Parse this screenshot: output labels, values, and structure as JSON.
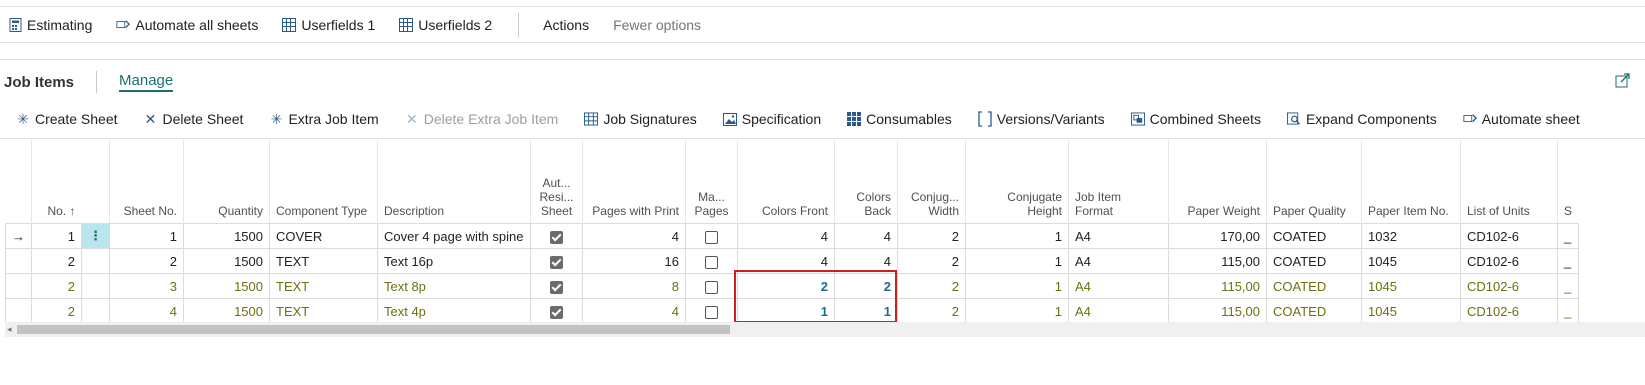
{
  "top_actions": {
    "estimating": "Estimating",
    "automate_all": "Automate all sheets",
    "userfields1": "Userfields 1",
    "userfields2": "Userfields 2",
    "actions": "Actions",
    "fewer_options": "Fewer options"
  },
  "part": {
    "title": "Job Items",
    "manage": "Manage"
  },
  "ribbon": {
    "create_sheet": "Create Sheet",
    "delete_sheet": "Delete Sheet",
    "extra_job_item": "Extra Job Item",
    "delete_extra_job_item": "Delete Extra Job Item",
    "job_signatures": "Job Signatures",
    "specification": "Specification",
    "consumables": "Consumables",
    "versions_variants": "Versions/Variants",
    "combined_sheets": "Combined Sheets",
    "expand_components": "Expand Components",
    "automate_sheet": "Automate sheet"
  },
  "columns": {
    "no": "No.",
    "sort": "↑",
    "sheet_no": "Sheet No.",
    "quantity": "Quantity",
    "component_type": "Component Type",
    "description": "Description",
    "auto_resize_1": "Aut...",
    "auto_resize_2": "Resi...",
    "auto_resize_3": "Sheet",
    "pages_with_print": "Pages with Print",
    "manual_pages_1": "Ma...",
    "manual_pages_2": "Pages",
    "colors_front": "Colors Front",
    "colors_back_1": "Colors",
    "colors_back_2": "Back",
    "conj_width_1": "Conjug...",
    "conj_width_2": "Width",
    "conj_height_1": "Conjugate",
    "conj_height_2": "Height",
    "format_1": "Job Item",
    "format_2": "Format",
    "paper_weight": "Paper Weight",
    "paper_quality": "Paper Quality",
    "paper_item_no": "Paper Item No.",
    "list_of_units": "List of Units",
    "last": "S"
  },
  "rows": [
    {
      "no": "1",
      "sheet_no": "1",
      "quantity": "1500",
      "component_type": "COVER",
      "description": "Cover 4 page with spine",
      "auto_resize": true,
      "pages_with_print": "4",
      "manual_pages": false,
      "colors_front": "4",
      "colors_back": "4",
      "conj_width": "2",
      "conj_height": "1",
      "format": "A4",
      "paper_weight": "170,00",
      "paper_quality": "COATED",
      "paper_item_no": "1032",
      "list_of_units": "CD102-6",
      "last": "_"
    },
    {
      "no": "2",
      "sheet_no": "2",
      "quantity": "1500",
      "component_type": "TEXT",
      "description": "Text 16p",
      "auto_resize": true,
      "pages_with_print": "16",
      "manual_pages": false,
      "colors_front": "4",
      "colors_back": "4",
      "conj_width": "2",
      "conj_height": "1",
      "format": "A4",
      "paper_weight": "115,00",
      "paper_quality": "COATED",
      "paper_item_no": "1045",
      "list_of_units": "CD102-6",
      "last": "_"
    },
    {
      "no": "2",
      "sheet_no": "3",
      "quantity": "1500",
      "component_type": "TEXT",
      "description": "Text 8p",
      "auto_resize": true,
      "pages_with_print": "8",
      "manual_pages": false,
      "colors_front": "2",
      "colors_back": "2",
      "conj_width": "2",
      "conj_height": "1",
      "format": "A4",
      "paper_weight": "115,00",
      "paper_quality": "COATED",
      "paper_item_no": "1045",
      "list_of_units": "CD102-6",
      "last": "_"
    },
    {
      "no": "2",
      "sheet_no": "4",
      "quantity": "1500",
      "component_type": "TEXT",
      "description": "Text 4p",
      "auto_resize": true,
      "pages_with_print": "4",
      "manual_pages": false,
      "colors_front": "1",
      "colors_back": "1",
      "conj_width": "2",
      "conj_height": "1",
      "format": "A4",
      "paper_weight": "115,00",
      "paper_quality": "COATED",
      "paper_item_no": "1045",
      "list_of_units": "CD102-6",
      "last": "_"
    }
  ],
  "row_menu": "⋮",
  "current_row_arrow": "→",
  "colors": {
    "accent": "#1b6e74",
    "olive_text": "#6f6f10",
    "highlight": "#cc2020"
  }
}
